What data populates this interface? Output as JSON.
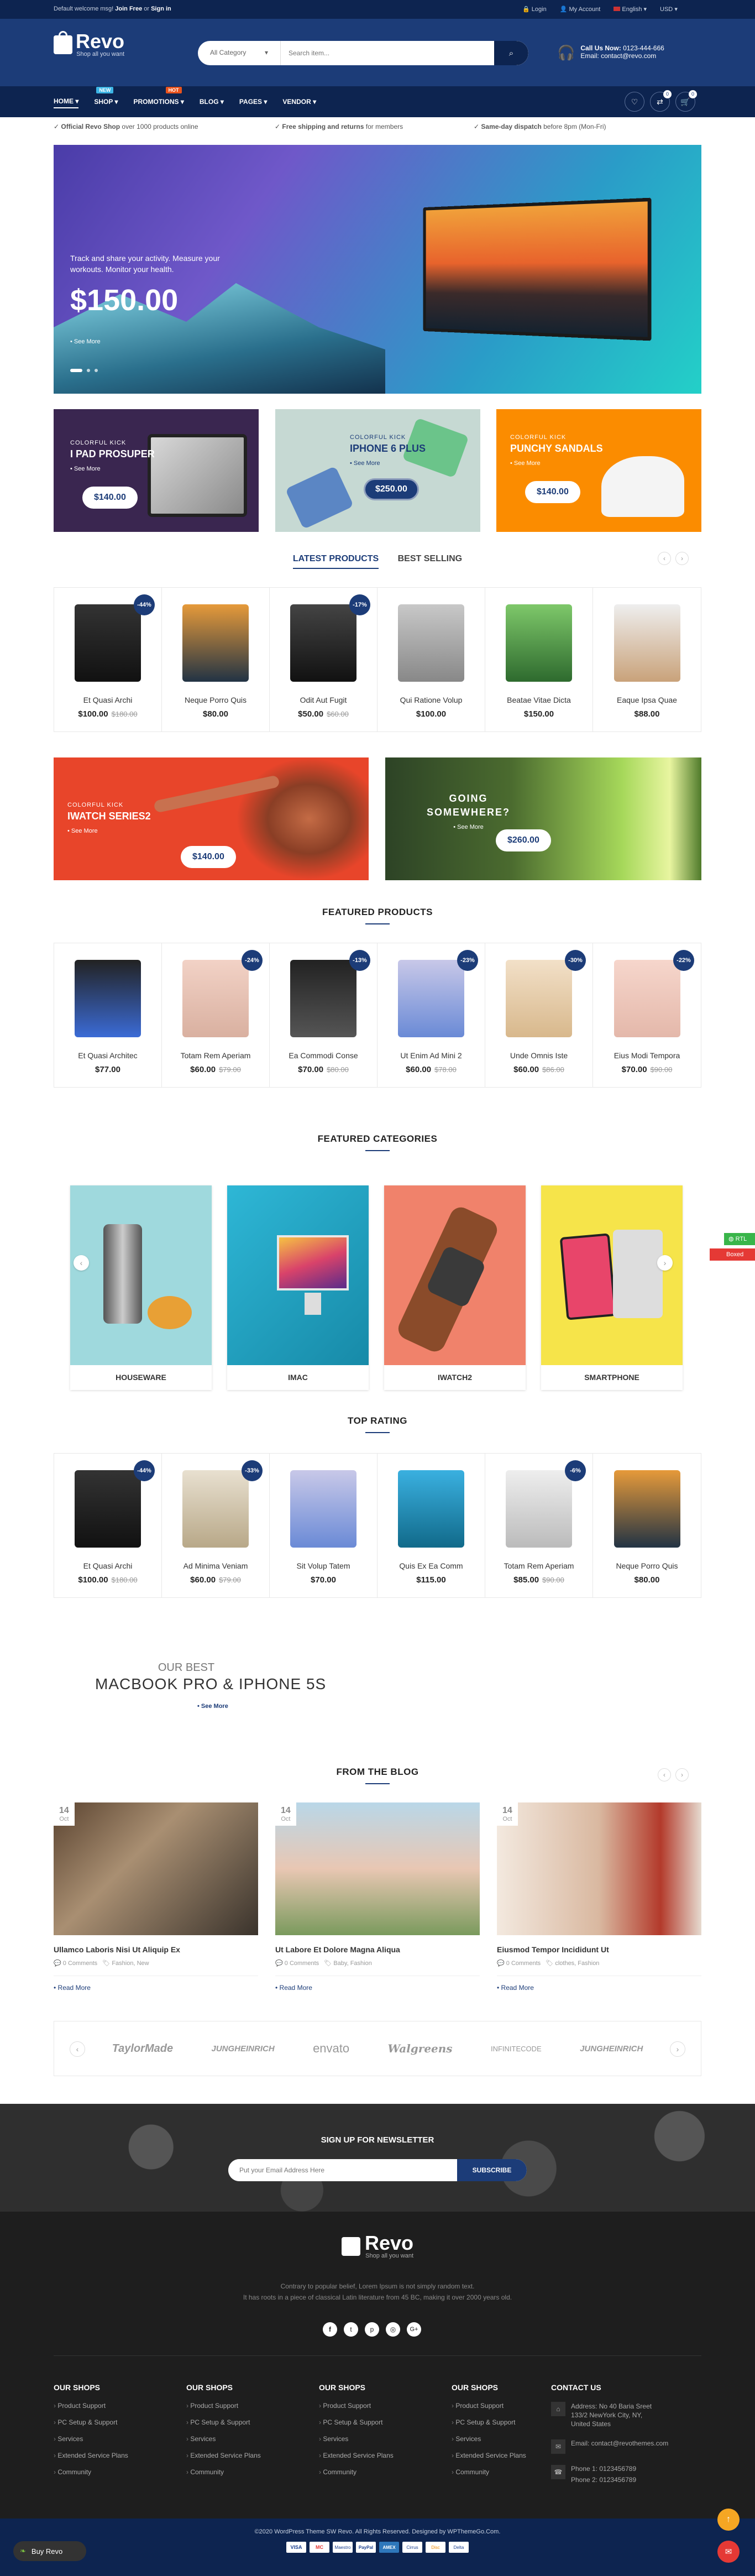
{
  "topbar": {
    "welcome_prefix": "Default welcome msg!",
    "join": "Join Free",
    "or": "or",
    "signin": "Sign in",
    "login": "Login",
    "account": "My Account",
    "language": "English",
    "currency": "USD"
  },
  "header": {
    "logo_text": "Revo",
    "logo_tagline": "Shop all you want",
    "category_label": "All Category",
    "search_placeholder": "Search item...",
    "call_label": "Call Us Now:",
    "phone": "0123-444-666",
    "email_label": "Email:",
    "email": "contact@revo.com",
    "cart_count": "0",
    "wishlist_count": "0",
    "compare_count": "0"
  },
  "nav": {
    "items": [
      {
        "label": "HOME",
        "badge": ""
      },
      {
        "label": "SHOP",
        "badge": "NEW"
      },
      {
        "label": "PROMOTIONS",
        "badge": "HOT"
      },
      {
        "label": "BLOG",
        "badge": ""
      },
      {
        "label": "PAGES",
        "badge": ""
      },
      {
        "label": "VENDOR",
        "badge": ""
      }
    ]
  },
  "features": [
    {
      "bold": "Official Revo Shop",
      "rest": " over 1000 products online"
    },
    {
      "bold": "Free shipping and returns",
      "rest": " for members"
    },
    {
      "bold": "Same-day dispatch",
      "rest": " before 8pm (Mon-Fri)"
    }
  ],
  "hero": {
    "line1": "Track and share your activity. Measure your",
    "line2": "workouts. Monitor your health.",
    "price": "$150.00",
    "cta": "See More"
  },
  "promos": [
    {
      "kicker": "COLORFUL KICK",
      "title": "I PAD PROSUPER",
      "more": "See More",
      "price": "$140.00"
    },
    {
      "kicker": "COLORFUL KICK",
      "title": "IPHONE 6 PLUS",
      "more": "See More",
      "price": "$250.00"
    },
    {
      "kicker": "COLORFUL KICK",
      "title": "PUNCHY SANDALS",
      "more": "See More",
      "price": "$140.00"
    }
  ],
  "tabs": {
    "active": "LATEST PRODUCTS",
    "other": "BEST SELLING"
  },
  "latest": [
    {
      "name": "Et Quasi Archi",
      "price": "$100.00",
      "old": "$180.00",
      "badge": "-44%"
    },
    {
      "name": "Neque Porro Quis",
      "price": "$80.00",
      "old": "",
      "badge": ""
    },
    {
      "name": "Odit Aut Fugit",
      "price": "$50.00",
      "old": "$60.00",
      "badge": "-17%"
    },
    {
      "name": "Qui Ratione Volup",
      "price": "$100.00",
      "old": "",
      "badge": ""
    },
    {
      "name": "Beatae Vitae Dicta",
      "price": "$150.00",
      "old": "",
      "badge": ""
    },
    {
      "name": "Eaque Ipsa Quae",
      "price": "$88.00",
      "old": "",
      "badge": ""
    }
  ],
  "mid_banners": [
    {
      "kicker": "COLORFUL KICK",
      "title": "IWATCH SERIES2",
      "more": "See More",
      "price": "$140.00"
    },
    {
      "title1": "GOING",
      "title2": "SOMEWHERE?",
      "more": "See More",
      "price": "$260.00"
    }
  ],
  "featured_title": "FEATURED PRODUCTS",
  "featured": [
    {
      "name": "Et Quasi Architec",
      "price": "$77.00",
      "old": "",
      "badge": ""
    },
    {
      "name": "Totam Rem Aperiam",
      "price": "$60.00",
      "old": "$79.00",
      "badge": "-24%"
    },
    {
      "name": "Ea Commodi Conse",
      "price": "$70.00",
      "old": "$80.00",
      "badge": "-13%"
    },
    {
      "name": "Ut Enim Ad Mini 2",
      "price": "$60.00",
      "old": "$78.00",
      "badge": "-23%"
    },
    {
      "name": "Unde Omnis Iste",
      "price": "$60.00",
      "old": "$86.00",
      "badge": "-30%"
    },
    {
      "name": "Eius Modi Tempora",
      "price": "$70.00",
      "old": "$90.00",
      "badge": "-22%"
    }
  ],
  "categories_title": "FEATURED CATEGORIES",
  "categories": [
    "HOUSEWARE",
    "IMAC",
    "IWATCH2",
    "SMARTPHONE"
  ],
  "side_tags": {
    "rtl": "RTL",
    "boxed": "Boxed"
  },
  "toprating_title": "TOP RATING",
  "toprating": [
    {
      "name": "Et Quasi Archi",
      "price": "$100.00",
      "old": "$180.00",
      "badge": "-44%"
    },
    {
      "name": "Ad Minima Veniam",
      "price": "$60.00",
      "old": "$79.00",
      "badge": "-33%"
    },
    {
      "name": "Sit Volup Tatem",
      "price": "$70.00",
      "old": "",
      "badge": ""
    },
    {
      "name": "Quis Ex Ea Comm",
      "price": "$115.00",
      "old": "",
      "badge": ""
    },
    {
      "name": "Totam Rem Aperiam",
      "price": "$85.00",
      "old": "$90.00",
      "badge": "-6%"
    },
    {
      "name": "Neque Porro Quis",
      "price": "$80.00",
      "old": "",
      "badge": ""
    }
  ],
  "macbook": {
    "small": "OUR BEST",
    "big": "MACBOOK PRO & IPHONE 5S",
    "more": "See More"
  },
  "blog_title": "FROM THE BLOG",
  "blog": [
    {
      "day": "14",
      "month": "Oct",
      "title": "Ullamco Laboris Nisi Ut Aliquip Ex",
      "comments": "0 Comments",
      "tags": "Fashion, New",
      "more": "Read More"
    },
    {
      "day": "14",
      "month": "Oct",
      "title": "Ut Labore Et Dolore Magna Aliqua",
      "comments": "0 Comments",
      "tags": "Baby, Fashion",
      "more": "Read More"
    },
    {
      "day": "14",
      "month": "Oct",
      "title": "Eiusmod Tempor Incididunt Ut",
      "comments": "0 Comments",
      "tags": "clothes, Fashion",
      "more": "Read More"
    }
  ],
  "brands": [
    "TaylorMade",
    "JUNGHEINRICH",
    "envato",
    "Walgreens",
    "INFINITECODE",
    "JUNGHEINRICH"
  ],
  "newsletter": {
    "title": "SIGN UP FOR NEWSLETTER",
    "placeholder": "Put your Email Address Here",
    "button": "SUBSCRIBE"
  },
  "footer": {
    "logo": "Revo",
    "tagline": "Shop all you want",
    "desc1": "Contrary to popular belief, Lorem Ipsum is not simply random text.",
    "desc2": "It has roots in a piece of classical Latin literature from 45 BC, making it over 2000 years old.",
    "cols": [
      {
        "title": "OUR SHOPS",
        "links": [
          "Product Support",
          "PC Setup & Support",
          "Services",
          "Extended Service Plans",
          "Community"
        ]
      },
      {
        "title": "OUR SHOPS",
        "links": [
          "Product Support",
          "PC Setup & Support",
          "Services",
          "Extended Service Plans",
          "Community"
        ]
      },
      {
        "title": "OUR SHOPS",
        "links": [
          "Product Support",
          "PC Setup & Support",
          "Services",
          "Extended Service Plans",
          "Community"
        ]
      },
      {
        "title": "OUR SHOPS",
        "links": [
          "Product Support",
          "PC Setup & Support",
          "Services",
          "Extended Service Plans",
          "Community"
        ]
      }
    ],
    "contact_title": "CONTACT US",
    "address": "Address: No 40 Baria Sreet 133/2 NewYork City, NY, United States",
    "email": "Email: contact@revothemes.com",
    "phone1": "Phone 1: 0123456789",
    "phone2": "Phone 2: 0123456789",
    "copyright": "©2020 WordPress Theme SW Revo. All Rights Reserved. Designed by WPThemeGo.Com.",
    "payments": [
      "VISA",
      "MC",
      "Maestro",
      "PayPal",
      "AMEX",
      "Cirrus",
      "Disc",
      "Delta"
    ],
    "buy": "Buy Revo"
  },
  "colors": {
    "primary": "#1c3c78",
    "accent": "#f5a623",
    "topbar": "#0d2450"
  }
}
